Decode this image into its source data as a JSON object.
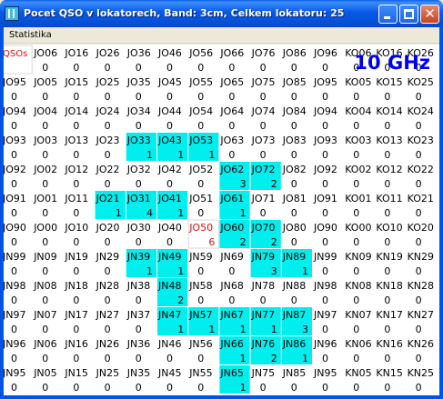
{
  "window": {
    "title": "Pocet QSO v lokatorech, Band: 3cm, Celkem lokatoru: 25"
  },
  "menu": {
    "items": [
      "Statistika"
    ]
  },
  "band_label": "10 GHz",
  "corner_label": "QSOs",
  "colors": {
    "cell_bg": "#ffffff",
    "worked": "#00eeee",
    "highlight": "#ffffff",
    "highlight_text": "#e01010",
    "text": "#000000",
    "band_label": "#0000f0"
  },
  "grid": {
    "rows": [
      [
        "QSOs",
        "JO06",
        "JO16",
        "JO26",
        "JO36",
        "JO46",
        "JO56",
        "JO66",
        "JO76",
        "JO86",
        "JO96",
        "KO06",
        "KO16",
        "KO26"
      ],
      [
        "JO95",
        "JO05",
        "JO15",
        "JO25",
        "JO35",
        "JO45",
        "JO55",
        "JO65",
        "JO75",
        "JO85",
        "JO95",
        "KO05",
        "KO15",
        "KO25"
      ],
      [
        "JO94",
        "JO04",
        "JO14",
        "JO24",
        "JO34",
        "JO44",
        "JO54",
        "JO64",
        "JO74",
        "JO84",
        "JO94",
        "KO04",
        "KO14",
        "KO24"
      ],
      [
        "JO93",
        "JO03",
        "JO13",
        "JO23",
        "JO33",
        "JO43",
        "JO53",
        "JO63",
        "JO73",
        "JO83",
        "JO93",
        "KO03",
        "KO13",
        "KO23"
      ],
      [
        "JO92",
        "JO02",
        "JO12",
        "JO22",
        "JO32",
        "JO42",
        "JO52",
        "JO62",
        "JO72",
        "JO82",
        "JO92",
        "KO02",
        "KO12",
        "KO22"
      ],
      [
        "JO91",
        "JO01",
        "JO11",
        "JO21",
        "JO31",
        "JO41",
        "JO51",
        "JO61",
        "JO71",
        "JO81",
        "JO91",
        "KO01",
        "KO11",
        "KO21"
      ],
      [
        "JO90",
        "JO00",
        "JO10",
        "JO20",
        "JO30",
        "JO40",
        "JO50",
        "JO60",
        "JO70",
        "JO80",
        "JO90",
        "KO00",
        "KO10",
        "KO20"
      ],
      [
        "JN99",
        "JN09",
        "JN19",
        "JN29",
        "JN39",
        "JN49",
        "JN59",
        "JN69",
        "JN79",
        "JN89",
        "JN99",
        "KN09",
        "KN19",
        "KN29"
      ],
      [
        "JN98",
        "JN08",
        "JN18",
        "JN28",
        "JN38",
        "JN48",
        "JN58",
        "JN68",
        "JN78",
        "JN88",
        "JN98",
        "KN08",
        "KN18",
        "KN28"
      ],
      [
        "JN97",
        "JN07",
        "JN17",
        "JN27",
        "JN37",
        "JN47",
        "JN57",
        "JN67",
        "JN77",
        "JN87",
        "JN97",
        "KN07",
        "KN17",
        "KN27"
      ],
      [
        "JN96",
        "JN06",
        "JN16",
        "JN26",
        "JN36",
        "JN46",
        "JN56",
        "JN66",
        "JN76",
        "JN86",
        "JN96",
        "KN06",
        "KN16",
        "KN26"
      ],
      [
        "JN95",
        "JN05",
        "JN15",
        "JN25",
        "JN35",
        "JN45",
        "JN55",
        "JN65",
        "JN75",
        "JN85",
        "JN95",
        "KN05",
        "KN15",
        "KN25"
      ]
    ],
    "counts": [
      [
        "",
        "0",
        "0",
        "0",
        "0",
        "0",
        "0",
        "0",
        "0",
        "0",
        "0",
        "0",
        "0",
        "0"
      ],
      [
        "0",
        "0",
        "0",
        "0",
        "0",
        "0",
        "0",
        "0",
        "0",
        "0",
        "0",
        "0",
        "0",
        "0"
      ],
      [
        "0",
        "0",
        "0",
        "0",
        "0",
        "0",
        "0",
        "0",
        "0",
        "0",
        "0",
        "0",
        "0",
        "0"
      ],
      [
        "0",
        "0",
        "0",
        "0",
        "1",
        "1",
        "1",
        "0",
        "0",
        "0",
        "0",
        "0",
        "0",
        "0"
      ],
      [
        "0",
        "0",
        "0",
        "0",
        "0",
        "0",
        "0",
        "3",
        "2",
        "0",
        "0",
        "0",
        "0",
        "0"
      ],
      [
        "0",
        "0",
        "0",
        "1",
        "4",
        "1",
        "0",
        "1",
        "0",
        "0",
        "0",
        "0",
        "0",
        "0"
      ],
      [
        "0",
        "0",
        "0",
        "0",
        "0",
        "0",
        "6",
        "2",
        "2",
        "0",
        "0",
        "0",
        "0",
        "0"
      ],
      [
        "0",
        "0",
        "0",
        "0",
        "1",
        "1",
        "0",
        "0",
        "3",
        "1",
        "0",
        "0",
        "0",
        "0"
      ],
      [
        "0",
        "0",
        "0",
        "0",
        "0",
        "2",
        "0",
        "0",
        "0",
        "0",
        "0",
        "0",
        "0",
        "0"
      ],
      [
        "0",
        "0",
        "0",
        "0",
        "0",
        "1",
        "1",
        "1",
        "1",
        "3",
        "0",
        "0",
        "0",
        "0"
      ],
      [
        "0",
        "0",
        "0",
        "0",
        "0",
        "0",
        "0",
        "1",
        "2",
        "1",
        "0",
        "0",
        "0",
        "0"
      ],
      [
        "0",
        "0",
        "0",
        "0",
        "0",
        "0",
        "0",
        "1",
        "0",
        "0",
        "0",
        "0",
        "0",
        "0"
      ]
    ],
    "states": [
      [
        "h",
        "n",
        "n",
        "n",
        "n",
        "n",
        "n",
        "n",
        "n",
        "n",
        "n",
        "n",
        "n",
        "n"
      ],
      [
        "n",
        "n",
        "n",
        "n",
        "n",
        "n",
        "n",
        "n",
        "n",
        "n",
        "n",
        "n",
        "n",
        "n"
      ],
      [
        "n",
        "n",
        "n",
        "n",
        "n",
        "n",
        "n",
        "n",
        "n",
        "n",
        "n",
        "n",
        "n",
        "n"
      ],
      [
        "n",
        "n",
        "n",
        "n",
        "w",
        "w",
        "w",
        "n",
        "n",
        "n",
        "n",
        "n",
        "n",
        "n"
      ],
      [
        "n",
        "n",
        "n",
        "n",
        "n",
        "n",
        "n",
        "w",
        "w",
        "n",
        "n",
        "n",
        "n",
        "n"
      ],
      [
        "n",
        "n",
        "n",
        "w",
        "w",
        "w",
        "n",
        "w",
        "n",
        "n",
        "n",
        "n",
        "n",
        "n"
      ],
      [
        "n",
        "n",
        "n",
        "n",
        "n",
        "n",
        "h",
        "w",
        "w",
        "n",
        "n",
        "n",
        "n",
        "n"
      ],
      [
        "n",
        "n",
        "n",
        "n",
        "w",
        "w",
        "n",
        "n",
        "w",
        "w",
        "n",
        "n",
        "n",
        "n"
      ],
      [
        "n",
        "n",
        "n",
        "n",
        "n",
        "w",
        "n",
        "n",
        "n",
        "n",
        "n",
        "n",
        "n",
        "n"
      ],
      [
        "n",
        "n",
        "n",
        "n",
        "n",
        "w",
        "w",
        "w",
        "w",
        "w",
        "n",
        "n",
        "n",
        "n"
      ],
      [
        "n",
        "n",
        "n",
        "n",
        "n",
        "n",
        "n",
        "w",
        "w",
        "w",
        "n",
        "n",
        "n",
        "n"
      ],
      [
        "n",
        "n",
        "n",
        "n",
        "n",
        "n",
        "n",
        "w",
        "n",
        "n",
        "n",
        "n",
        "n",
        "n"
      ]
    ]
  }
}
